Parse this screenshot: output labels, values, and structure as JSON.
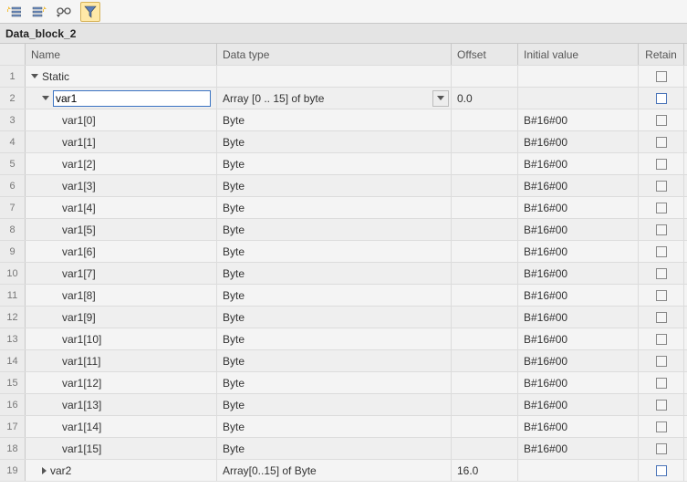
{
  "title": "Data_block_2",
  "columns": {
    "name": "Name",
    "dataType": "Data type",
    "offset": "Offset",
    "initial": "Initial value",
    "retain": "Retain"
  },
  "rows": [
    {
      "num": "1",
      "indent": 0,
      "expand": "down",
      "name": "Static",
      "type": "",
      "offset": "",
      "init": "",
      "retainEnabled": false,
      "dropdown": false,
      "editing": false
    },
    {
      "num": "2",
      "indent": 1,
      "expand": "down",
      "name": "var1",
      "type": "Array [0 .. 15] of byte",
      "offset": "0.0",
      "init": "",
      "retainEnabled": true,
      "dropdown": true,
      "editing": true
    },
    {
      "num": "3",
      "indent": 2,
      "expand": "none",
      "name": "var1[0]",
      "type": "Byte",
      "offset": "",
      "init": "B#16#00",
      "retainEnabled": false,
      "dropdown": false,
      "editing": false
    },
    {
      "num": "4",
      "indent": 2,
      "expand": "none",
      "name": "var1[1]",
      "type": "Byte",
      "offset": "",
      "init": "B#16#00",
      "retainEnabled": false,
      "dropdown": false,
      "editing": false
    },
    {
      "num": "5",
      "indent": 2,
      "expand": "none",
      "name": "var1[2]",
      "type": "Byte",
      "offset": "",
      "init": "B#16#00",
      "retainEnabled": false,
      "dropdown": false,
      "editing": false
    },
    {
      "num": "6",
      "indent": 2,
      "expand": "none",
      "name": "var1[3]",
      "type": "Byte",
      "offset": "",
      "init": "B#16#00",
      "retainEnabled": false,
      "dropdown": false,
      "editing": false
    },
    {
      "num": "7",
      "indent": 2,
      "expand": "none",
      "name": "var1[4]",
      "type": "Byte",
      "offset": "",
      "init": "B#16#00",
      "retainEnabled": false,
      "dropdown": false,
      "editing": false
    },
    {
      "num": "8",
      "indent": 2,
      "expand": "none",
      "name": "var1[5]",
      "type": "Byte",
      "offset": "",
      "init": "B#16#00",
      "retainEnabled": false,
      "dropdown": false,
      "editing": false
    },
    {
      "num": "9",
      "indent": 2,
      "expand": "none",
      "name": "var1[6]",
      "type": "Byte",
      "offset": "",
      "init": "B#16#00",
      "retainEnabled": false,
      "dropdown": false,
      "editing": false
    },
    {
      "num": "10",
      "indent": 2,
      "expand": "none",
      "name": "var1[7]",
      "type": "Byte",
      "offset": "",
      "init": "B#16#00",
      "retainEnabled": false,
      "dropdown": false,
      "editing": false
    },
    {
      "num": "11",
      "indent": 2,
      "expand": "none",
      "name": "var1[8]",
      "type": "Byte",
      "offset": "",
      "init": "B#16#00",
      "retainEnabled": false,
      "dropdown": false,
      "editing": false
    },
    {
      "num": "12",
      "indent": 2,
      "expand": "none",
      "name": "var1[9]",
      "type": "Byte",
      "offset": "",
      "init": "B#16#00",
      "retainEnabled": false,
      "dropdown": false,
      "editing": false
    },
    {
      "num": "13",
      "indent": 2,
      "expand": "none",
      "name": "var1[10]",
      "type": "Byte",
      "offset": "",
      "init": "B#16#00",
      "retainEnabled": false,
      "dropdown": false,
      "editing": false
    },
    {
      "num": "14",
      "indent": 2,
      "expand": "none",
      "name": "var1[11]",
      "type": "Byte",
      "offset": "",
      "init": "B#16#00",
      "retainEnabled": false,
      "dropdown": false,
      "editing": false
    },
    {
      "num": "15",
      "indent": 2,
      "expand": "none",
      "name": "var1[12]",
      "type": "Byte",
      "offset": "",
      "init": "B#16#00",
      "retainEnabled": false,
      "dropdown": false,
      "editing": false
    },
    {
      "num": "16",
      "indent": 2,
      "expand": "none",
      "name": "var1[13]",
      "type": "Byte",
      "offset": "",
      "init": "B#16#00",
      "retainEnabled": false,
      "dropdown": false,
      "editing": false
    },
    {
      "num": "17",
      "indent": 2,
      "expand": "none",
      "name": "var1[14]",
      "type": "Byte",
      "offset": "",
      "init": "B#16#00",
      "retainEnabled": false,
      "dropdown": false,
      "editing": false
    },
    {
      "num": "18",
      "indent": 2,
      "expand": "none",
      "name": "var1[15]",
      "type": "Byte",
      "offset": "",
      "init": "B#16#00",
      "retainEnabled": false,
      "dropdown": false,
      "editing": false
    },
    {
      "num": "19",
      "indent": 1,
      "expand": "right",
      "name": "var2",
      "type": "Array[0..15] of Byte",
      "offset": "16.0",
      "init": "",
      "retainEnabled": true,
      "dropdown": false,
      "editing": false
    }
  ]
}
